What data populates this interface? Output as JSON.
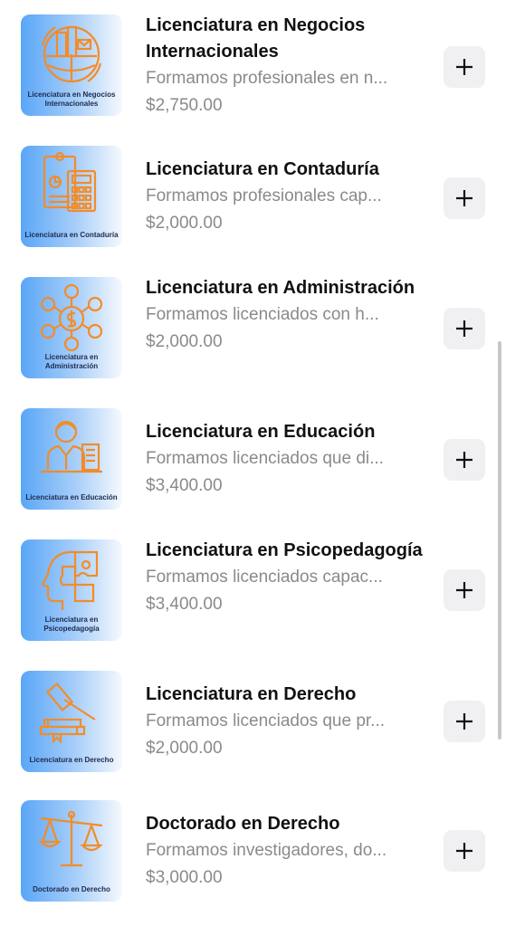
{
  "items": [
    {
      "thumb_caption": "Licenciatura en Negocios Internacionales",
      "icon": "globe-buildings-icon",
      "title": "Licenciatura en Negocios Internacionales",
      "description": "Formamos profesionales en n...",
      "price": "$2,750.00"
    },
    {
      "thumb_caption": "Licenciatura en Contaduría",
      "icon": "calculator-report-icon",
      "title": "Licenciatura en Contaduría",
      "description": "Formamos profesionales cap...",
      "price": "$2,000.00"
    },
    {
      "thumb_caption": "Licenciatura en Administración",
      "icon": "management-network-icon",
      "title": "Licenciatura en Administración",
      "description": "Formamos licenciados con h...",
      "price": "$2,000.00"
    },
    {
      "thumb_caption": "Licenciatura en Educación",
      "icon": "teacher-book-icon",
      "title": "Licenciatura en Educación",
      "description": "Formamos licenciados que di...",
      "price": "$3,400.00"
    },
    {
      "thumb_caption": "Licenciatura en Psicopedagogía",
      "icon": "head-puzzle-icon",
      "title": "Licenciatura en Psicopedagogía",
      "description": "Formamos licenciados capac...",
      "price": "$3,400.00"
    },
    {
      "thumb_caption": "Licenciatura en Derecho",
      "icon": "gavel-books-icon",
      "title": "Licenciatura en Derecho",
      "description": "Formamos licenciados que pr...",
      "price": "$2,000.00"
    },
    {
      "thumb_caption": "Doctorado en Derecho",
      "icon": "scales-of-justice-icon",
      "title": "Doctorado en Derecho",
      "description": "Formamos investigadores, do...",
      "price": "$3,000.00"
    }
  ],
  "add_icon": "plus-icon",
  "colors": {
    "accent_orange": "#f28c28",
    "thumb_blue": "#5aa6f7",
    "title": "#111111",
    "secondary": "#8a8a8e",
    "button_bg": "#f0f0f2"
  }
}
